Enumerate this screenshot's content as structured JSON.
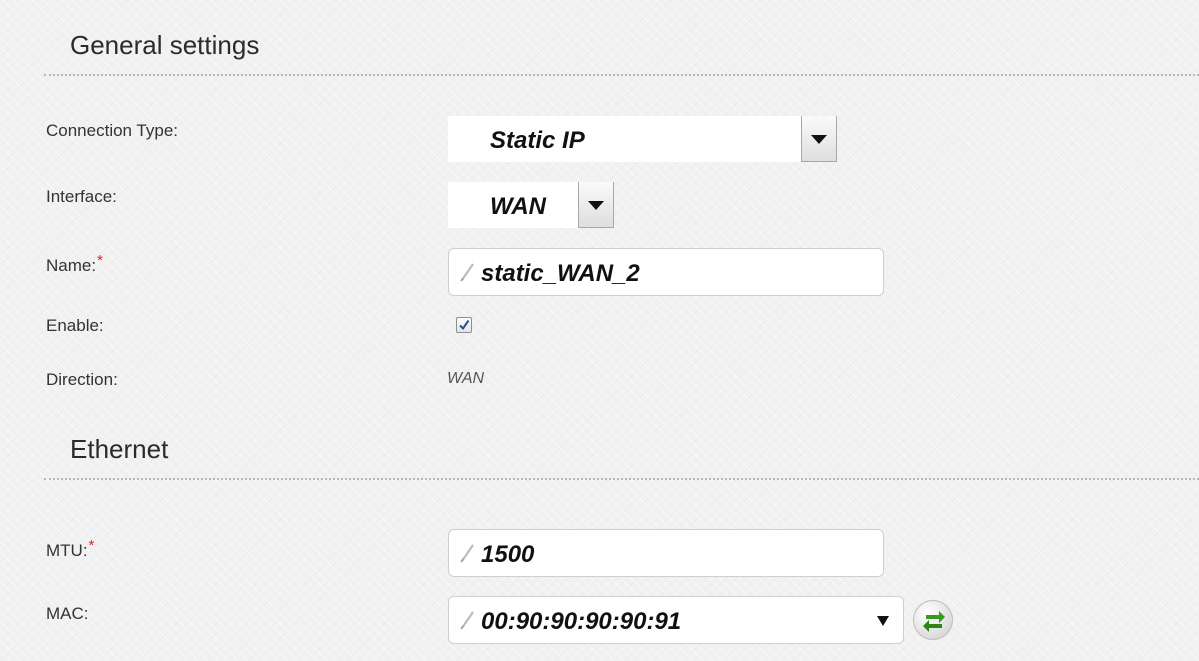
{
  "general_settings": {
    "title": "General settings",
    "connection_type": {
      "label": "Connection Type:",
      "value": "Static IP"
    },
    "interface": {
      "label": "Interface:",
      "value": "WAN"
    },
    "name": {
      "label": "Name:",
      "required_mark": "*",
      "value": "static_WAN_2"
    },
    "enable": {
      "label": "Enable:",
      "checked": true
    },
    "direction": {
      "label": "Direction:",
      "value": "WAN"
    }
  },
  "ethernet": {
    "title": "Ethernet",
    "mtu": {
      "label": "MTU:",
      "required_mark": "*",
      "value": "1500"
    },
    "mac": {
      "label": "MAC:",
      "value": "00:90:90:90:90:91",
      "refresh_icon": "refresh-arrows-icon"
    }
  },
  "colors": {
    "required": "#e02020",
    "refresh_green": "#3a9a1e",
    "check_blue": "#2a4d9c"
  }
}
